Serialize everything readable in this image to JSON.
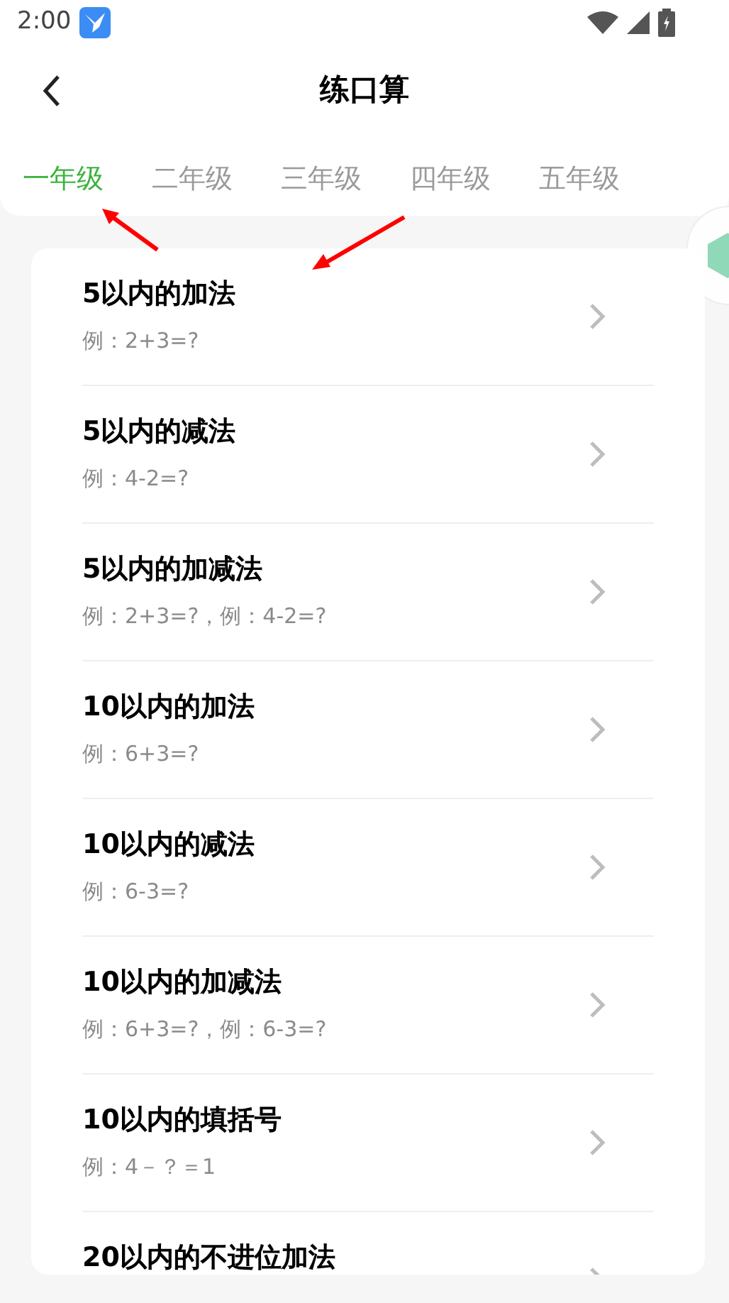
{
  "status_bar": {
    "time": "2:00"
  },
  "header": {
    "title": "练口算"
  },
  "tabs": [
    {
      "label": "一年级",
      "selected": true
    },
    {
      "label": "二年级",
      "selected": false
    },
    {
      "label": "三年级",
      "selected": false
    },
    {
      "label": "四年级",
      "selected": false
    },
    {
      "label": "五年级",
      "selected": false
    }
  ],
  "exercises": [
    {
      "title": "5以内的加法",
      "example": "例：2+3=?"
    },
    {
      "title": "5以内的减法",
      "example": "例：4-2=?"
    },
    {
      "title": "5以内的加减法",
      "example": "例：2+3=?，例：4-2=?"
    },
    {
      "title": "10以内的加法",
      "example": "例：6+3=?"
    },
    {
      "title": "10以内的减法",
      "example": "例：6-3=?"
    },
    {
      "title": "10以内的加减法",
      "example": "例：6+3=?，例：6-3=?"
    },
    {
      "title": "10以内的填括号",
      "example": "例：4－？＝1"
    },
    {
      "title": "20以内的不进位加法"
    }
  ]
}
